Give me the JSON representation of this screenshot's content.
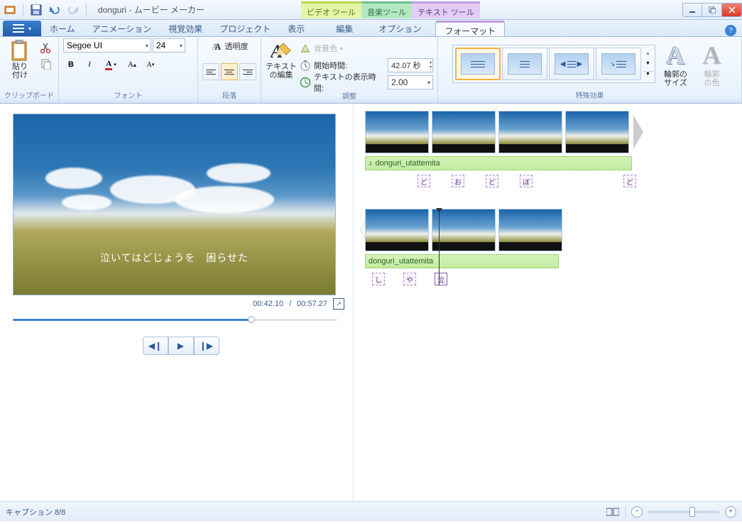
{
  "title": "donguri - ムービー メーカー",
  "contextual": {
    "video": "ビデオ ツール",
    "audio": "音楽ツール",
    "text": "テキスト ツール"
  },
  "tabs": {
    "file_icon": "≣",
    "home": "ホーム",
    "animation": "アニメーション",
    "visual": "視覚効果",
    "project": "プロジェクト",
    "view": "表示",
    "edit": "編集",
    "option": "オプション",
    "format": "フォーマット"
  },
  "ribbon": {
    "clipboard": {
      "label": "クリップボード",
      "paste": "貼り\n付け"
    },
    "font": {
      "label": "フォント",
      "name": "Segoe UI",
      "size": "24",
      "transparency": "透明度",
      "bold": "B",
      "italic": "I"
    },
    "paragraph": {
      "label": "段落",
      "edit_text": "テキスト\nの編集"
    },
    "adjust": {
      "label": "調整",
      "bg_color": "背景色",
      "start_time": "開始時間:",
      "start_time_val": "42.07 秒",
      "display_time": "テキストの表示時間:",
      "display_time_val": "2.00"
    },
    "effects": {
      "label": "特殊効果"
    },
    "outline": {
      "size": "輪郭の\nサイズ",
      "color": "輪郭\nの色"
    }
  },
  "preview": {
    "caption": "泣いてはどじょうを　困らせた",
    "current": "00:42.10",
    "total": "00:57.27"
  },
  "timeline": {
    "audio1": "donguri_utattemita",
    "audio2": "donguri_utattemita",
    "markers1": [
      "ど",
      "お",
      "ど",
      "ぼ",
      "ど"
    ],
    "markers2": [
      "し",
      "や",
      "泣"
    ]
  },
  "status": {
    "caption": "キャプション 8/8"
  }
}
